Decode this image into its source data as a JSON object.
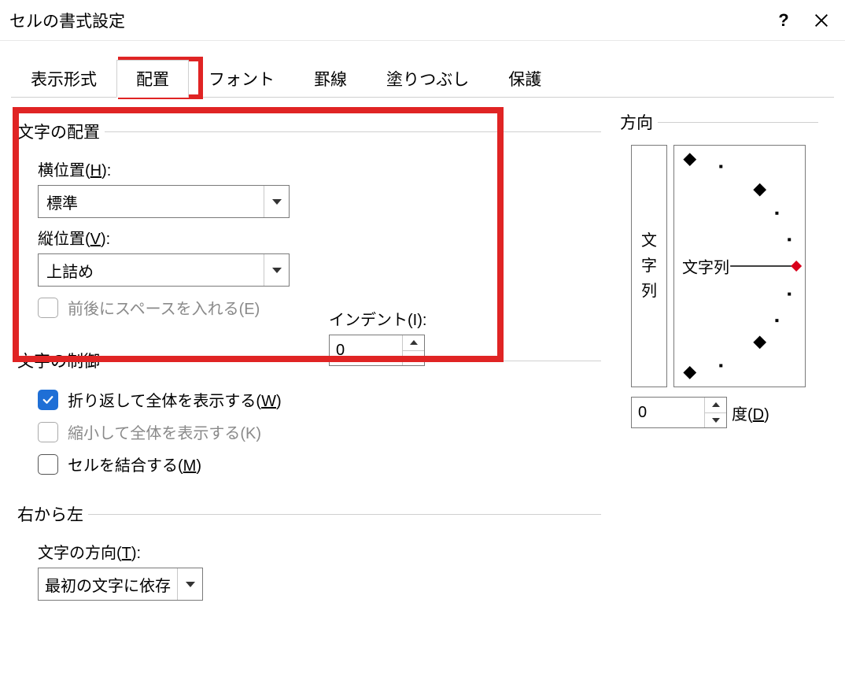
{
  "window": {
    "title": "セルの書式設定"
  },
  "tabs": {
    "display_format": "表示形式",
    "alignment": "配置",
    "font": "フォント",
    "border": "罫線",
    "fill": "塗りつぶし",
    "protection": "保護"
  },
  "groups": {
    "text_alignment": "文字の配置",
    "text_control": "文字の制御",
    "right_to_left": "右から左",
    "orientation": "方向"
  },
  "alignment": {
    "horizontal_label": "横位置(",
    "horizontal_mn": "H",
    "horizontal_label2": "):",
    "horizontal_value": "標準",
    "vertical_label": "縦位置(",
    "vertical_mn": "V",
    "vertical_label2": "):",
    "vertical_value": "上詰め",
    "indent_label": "インデント(I):",
    "indent_value": "0",
    "justify_distributed_label": "前後にスペースを入れる(E)"
  },
  "control": {
    "wrap_label_pre": "折り返して全体を表示する(",
    "wrap_mn": "W",
    "wrap_label_post": ")",
    "shrink_label": "縮小して全体を表示する(K)",
    "merge_label_pre": "セルを結合する(",
    "merge_mn": "M",
    "merge_label_post": ")"
  },
  "rtl": {
    "direction_label_pre": "文字の方向(",
    "direction_mn": "T",
    "direction_label_post": "):",
    "direction_value": "最初の文字に依存"
  },
  "orientation": {
    "vertical_text_1": "文",
    "vertical_text_2": "字",
    "vertical_text_3": "列",
    "dial_label": "文字列",
    "degree_value": "0",
    "degree_label_pre": "度(",
    "degree_mn": "D",
    "degree_label_post": ")"
  }
}
